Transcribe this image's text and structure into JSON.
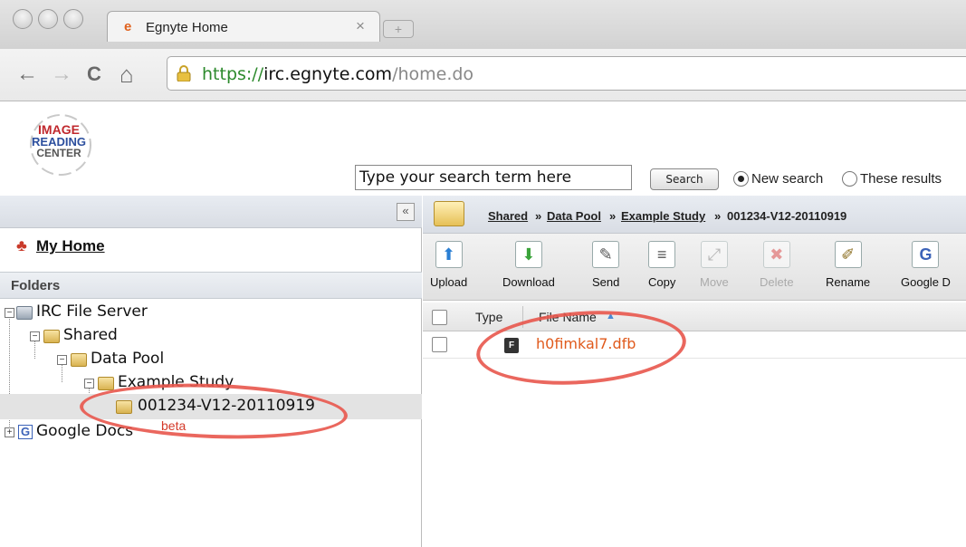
{
  "browser": {
    "tab_title": "Egnyte Home",
    "tab_close": "×",
    "url_scheme": "https://",
    "url_host": "irc.egnyte.com",
    "url_path": "/home.do",
    "back_glyph": "←",
    "forward_glyph": "→",
    "reload_glyph": "C",
    "home_glyph": "⌂"
  },
  "logo": {
    "line1": "IMAGE",
    "line2": "READING",
    "line3": "CENTER"
  },
  "search": {
    "value": "Type your search term here",
    "button_label": "Search",
    "option_new": "New search",
    "option_these": "These results",
    "selected": "New search"
  },
  "left_panel": {
    "collapse_glyph": "«",
    "my_home": "My Home",
    "folders_title": "Folders",
    "tree": {
      "root": "IRC File Server",
      "shared": "Shared",
      "data_pool": "Data Pool",
      "example_study": "Example Study",
      "selected_folder": "001234-V12-20110919",
      "google_docs": "Google Docs",
      "beta_badge": "beta"
    }
  },
  "breadcrumb": {
    "items": [
      "Shared",
      "Data Pool",
      "Example Study",
      "001234-V12-20110919"
    ],
    "separator": "»"
  },
  "toolbar": {
    "upload": "Upload",
    "download": "Download",
    "send": "Send",
    "copy": "Copy",
    "move": "Move",
    "delete": "Delete",
    "rename": "Rename",
    "google_docs": "Google D"
  },
  "file_list": {
    "columns": [
      "Type",
      "File Name"
    ],
    "rows": [
      {
        "type_icon": "F",
        "name": "h0fimkal7.dfb"
      }
    ]
  },
  "colors": {
    "accent_orange": "#e05a1c",
    "annotation_red": "#e8574d"
  }
}
